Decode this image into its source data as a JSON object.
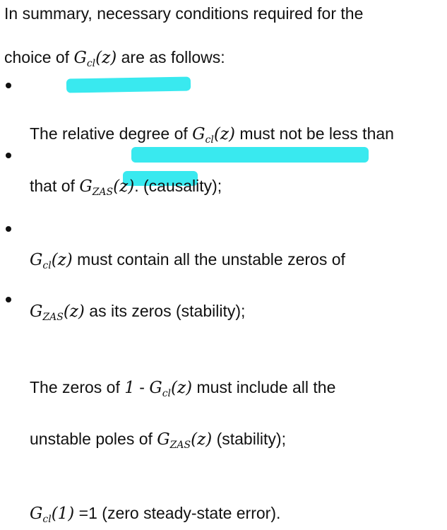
{
  "intro": {
    "line1": "In summary, necessary conditions required for the",
    "line2_pre": "choice of ",
    "line2_post": " are as follows:"
  },
  "symbols": {
    "G": "G",
    "cl": "cl",
    "zas": "ZAS",
    "z_arg": "(z)",
    "one_arg": "(1)"
  },
  "bullets": [
    {
      "line1_pre": "The ",
      "line1_hl": "relative degree ",
      "line1_mid": "of ",
      "line1_post": " must not be less than",
      "line2_pre": "that of ",
      "line2_post": ". (causality);"
    },
    {
      "line1_mid": " must ",
      "line1_hl": "contain all the unstable zeros",
      "line1_post": " of",
      "line2_mid": " as ",
      "line2_hl": "its zeros (",
      "line2_post": "stability);"
    },
    {
      "line1_pre": "The zeros of ",
      "line1_one": "1",
      "line1_dash": " - ",
      "line1_post": " must include all the",
      "line2_pre": "unstable poles of ",
      "line2_post": " (stability);"
    },
    {
      "line1_post": " =1 (zero steady-state error)."
    }
  ],
  "highlight_color": "#2ee8ee"
}
